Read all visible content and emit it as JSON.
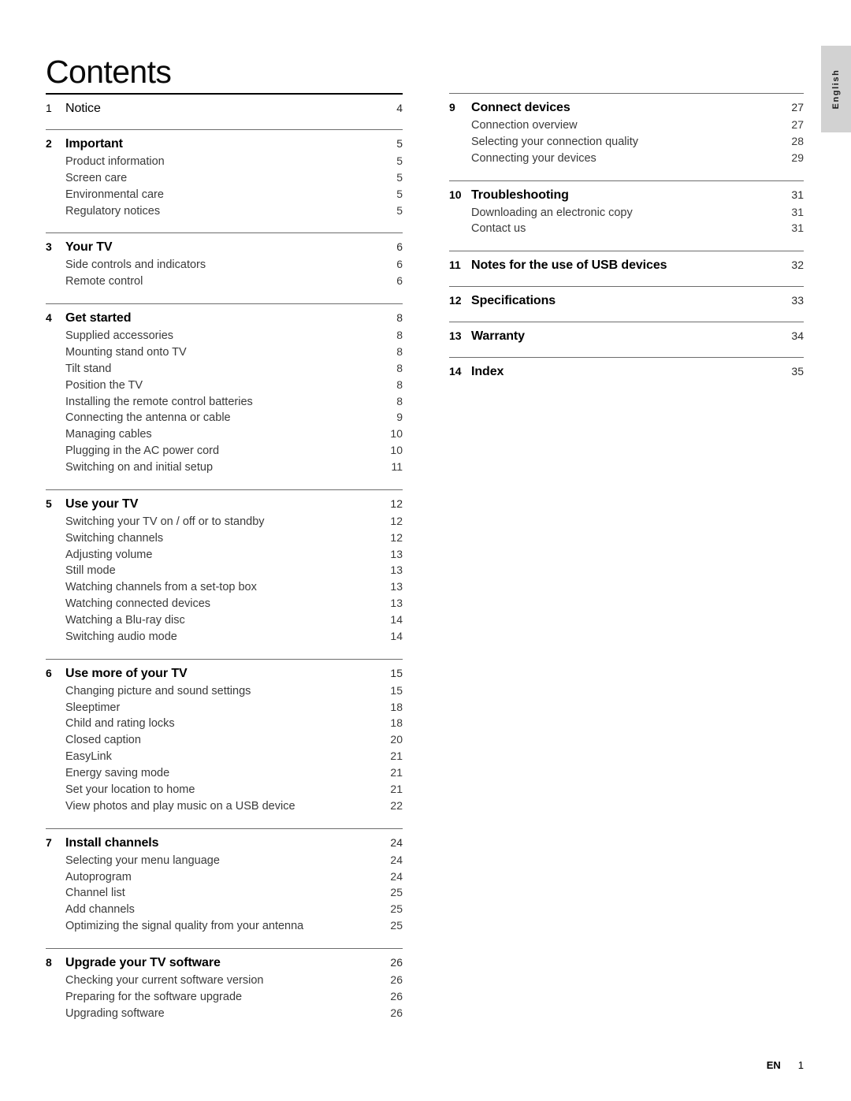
{
  "page_title": "Contents",
  "language_tab": "English",
  "footer": {
    "lang_code": "EN",
    "page_number": "1"
  },
  "columns": {
    "left": [
      {
        "number": "1",
        "title": "Notice",
        "page": "4",
        "weight": "regular",
        "items": []
      },
      {
        "number": "2",
        "title": "Important",
        "page": "5",
        "weight": "bold",
        "items": [
          {
            "label": "Product information",
            "page": "5"
          },
          {
            "label": "Screen care",
            "page": "5"
          },
          {
            "label": "Environmental care",
            "page": "5"
          },
          {
            "label": "Regulatory notices",
            "page": "5"
          }
        ]
      },
      {
        "number": "3",
        "title": "Your TV",
        "page": "6",
        "weight": "bold",
        "items": [
          {
            "label": "Side controls and indicators",
            "page": "6"
          },
          {
            "label": "Remote control",
            "page": "6"
          }
        ]
      },
      {
        "number": "4",
        "title": "Get started",
        "page": "8",
        "weight": "bold",
        "items": [
          {
            "label": "Supplied accessories",
            "page": "8"
          },
          {
            "label": "Mounting stand onto TV",
            "page": "8"
          },
          {
            "label": "Tilt stand",
            "page": "8"
          },
          {
            "label": "Position the TV",
            "page": "8"
          },
          {
            "label": "Installing the remote control batteries",
            "page": "8"
          },
          {
            "label": "Connecting the antenna or cable",
            "page": "9"
          },
          {
            "label": "Managing cables",
            "page": "10"
          },
          {
            "label": "Plugging in the AC power cord",
            "page": "10"
          },
          {
            "label": "Switching on and initial setup",
            "page": "11"
          }
        ]
      },
      {
        "number": "5",
        "title": "Use your TV",
        "page": "12",
        "weight": "bold",
        "items": [
          {
            "label": "Switching your TV on / off or to standby",
            "page": "12"
          },
          {
            "label": "Switching channels",
            "page": "12"
          },
          {
            "label": "Adjusting volume",
            "page": "13"
          },
          {
            "label": "Still mode",
            "page": "13"
          },
          {
            "label": "Watching channels from a set-top box",
            "page": "13"
          },
          {
            "label": "Watching connected devices",
            "page": "13"
          },
          {
            "label": "Watching a Blu-ray disc",
            "page": "14"
          },
          {
            "label": "Switching audio mode",
            "page": "14"
          }
        ]
      },
      {
        "number": "6",
        "title": "Use more of your TV",
        "page": "15",
        "weight": "bold",
        "items": [
          {
            "label": "Changing picture and sound settings",
            "page": "15"
          },
          {
            "label": "Sleeptimer",
            "page": "18"
          },
          {
            "label": "Child and rating locks",
            "page": "18"
          },
          {
            "label": "Closed caption",
            "page": "20"
          },
          {
            "label": "EasyLink",
            "page": "21"
          },
          {
            "label": "Energy saving mode",
            "page": "21"
          },
          {
            "label": "Set your location to home",
            "page": "21"
          },
          {
            "label": "View photos and play music on a USB device",
            "page": "22"
          }
        ]
      },
      {
        "number": "7",
        "title": "Install channels",
        "page": "24",
        "weight": "bold",
        "items": [
          {
            "label": "Selecting your menu language",
            "page": "24"
          },
          {
            "label": "Autoprogram",
            "page": "24"
          },
          {
            "label": "Channel list",
            "page": "25"
          },
          {
            "label": "Add channels",
            "page": "25"
          },
          {
            "label": "Optimizing the signal quality from your antenna",
            "page": "25"
          }
        ]
      },
      {
        "number": "8",
        "title": "Upgrade your TV software",
        "page": "26",
        "weight": "bold",
        "items": [
          {
            "label": "Checking your current software version",
            "page": "26"
          },
          {
            "label": "Preparing for the software upgrade",
            "page": "26"
          },
          {
            "label": "Upgrading software",
            "page": "26"
          }
        ]
      }
    ],
    "right": [
      {
        "number": "9",
        "title": "Connect devices",
        "page": "27",
        "weight": "bold",
        "items": [
          {
            "label": "Connection overview",
            "page": "27"
          },
          {
            "label": "Selecting your connection quality",
            "page": "28"
          },
          {
            "label": "Connecting your devices",
            "page": "29"
          }
        ]
      },
      {
        "number": "10",
        "title": "Troubleshooting",
        "page": "31",
        "weight": "bold",
        "items": [
          {
            "label": "Downloading an electronic copy",
            "page": "31"
          },
          {
            "label": "Contact us",
            "page": "31"
          }
        ]
      },
      {
        "number": "11",
        "title": "Notes for the use of USB devices",
        "page": "32",
        "weight": "bold",
        "items": []
      },
      {
        "number": "12",
        "title": "Specifications",
        "page": "33",
        "weight": "bold",
        "items": []
      },
      {
        "number": "13",
        "title": "Warranty",
        "page": "34",
        "weight": "bold",
        "items": []
      },
      {
        "number": "14",
        "title": "Index",
        "page": "35",
        "weight": "bold",
        "items": []
      }
    ]
  }
}
